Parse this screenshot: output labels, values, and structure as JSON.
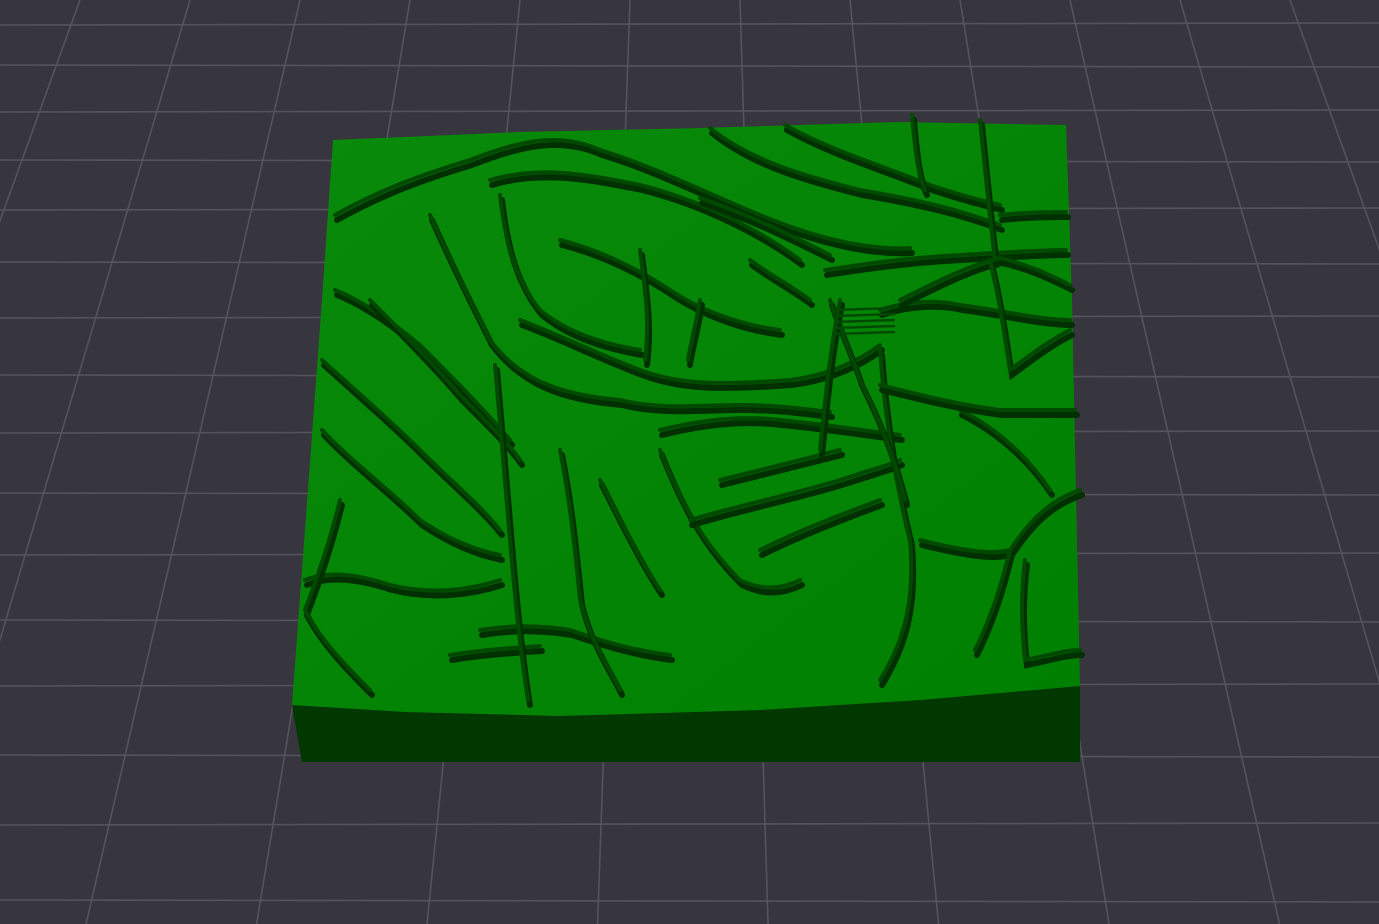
{
  "scene": {
    "kind": "3d-viewport",
    "background_color": "#37353d",
    "grid_color": "#55535c",
    "model": {
      "description_icon": "terrain-map-model",
      "top_color": "#008000",
      "top_light_color": "#0a8a0a",
      "side_color": "#003800",
      "road_color": "#004a00",
      "road_shadow_color": "#003000"
    }
  }
}
